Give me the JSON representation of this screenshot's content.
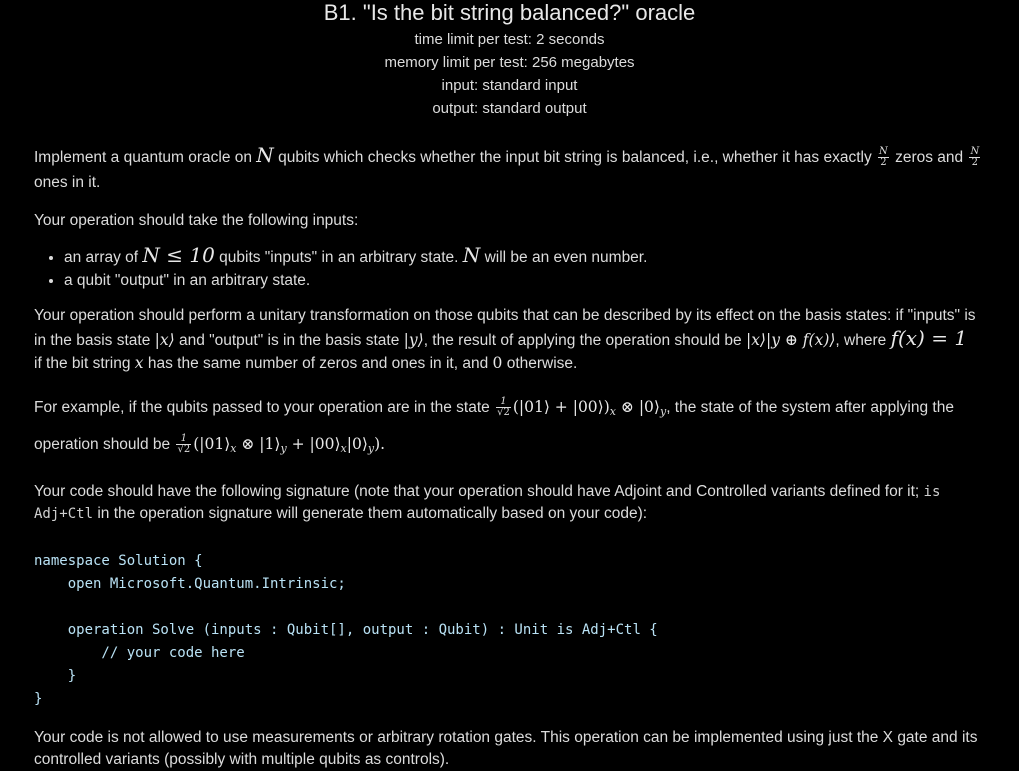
{
  "header": {
    "title": "B1. \"Is the bit string balanced?\" oracle",
    "time_limit": "time limit per test: 2 seconds",
    "memory_limit": "memory limit per test: 256 megabytes",
    "input": "input: standard input",
    "output": "output: standard output"
  },
  "statement": {
    "p1_a": "Implement a quantum oracle on ",
    "p1_b": " qubits which checks whether the input bit string is balanced, i.e., whether it has exactly ",
    "p1_c": " zeros and ",
    "p1_d": "ones in it.",
    "p2": "Your operation should take the following inputs:",
    "li1_a": "an array of ",
    "li1_b": " qubits \"inputs\" in an arbitrary state. ",
    "li1_c": " will be an even number.",
    "li2": "a qubit \"output\" in an arbitrary state.",
    "p3_a": "Your operation should perform a unitary transformation on those qubits that can be described by its effect on the basis states: if \"inputs\" is",
    "p3_b": "in the basis state ",
    "p3_c": " and \"output\" is in the basis state ",
    "p3_d": ", the result of applying the operation should be ",
    "p3_e": ", where ",
    "p3_f": "if the bit string ",
    "p3_g": " has the same number of zeros and ones in it, and ",
    "p3_h": " otherwise.",
    "p4_a": "For example, if the qubits passed to your operation are in the state ",
    "p4_b": ", the state of the system after applying the",
    "p4_c": "operation should be ",
    "p5_a": "Your code should have the following signature (note that your operation should have Adjoint and Controlled variants defined for it; ",
    "p5_is": "is",
    "p5_adj": "Adj+Ctl",
    "p5_b": " in the operation signature will generate them automatically based on your code):",
    "p6": "Your code is not allowed to use measurements or arbitrary rotation gates. This operation can be implemented using just the X gate and its controlled variants (possibly with multiple qubits as controls)."
  },
  "math": {
    "N": "N",
    "half_num": "N",
    "half_den": "2",
    "cond": "N ≤ 10",
    "x_ket": "|x⟩",
    "y_ket": "|y⟩",
    "result": "|x⟩|y ⊕ f(x)⟩",
    "f_eq": "f(x) = 1",
    "x": "x",
    "zero": "0",
    "frac_num": "1",
    "frac_den": "√2",
    "state_in": "(|01⟩ + |00⟩)",
    "state_in_tail": " ⊗ |0⟩",
    "state_out_a": "(|01⟩",
    "state_out_b": " ⊗ |1⟩",
    "state_out_c": " + |00⟩",
    "state_out_d": "|0⟩",
    "state_out_e": ").",
    "sub_x": "x",
    "sub_y": "y"
  },
  "code": {
    "line1": "namespace Solution {",
    "line2": "    open Microsoft.Quantum.Intrinsic;",
    "line3": "",
    "line4": "    operation Solve (inputs : Qubit[], output : Qubit) : Unit is Adj+Ctl {",
    "line5": "        // your code here",
    "line6": "    }",
    "line7": "}"
  }
}
